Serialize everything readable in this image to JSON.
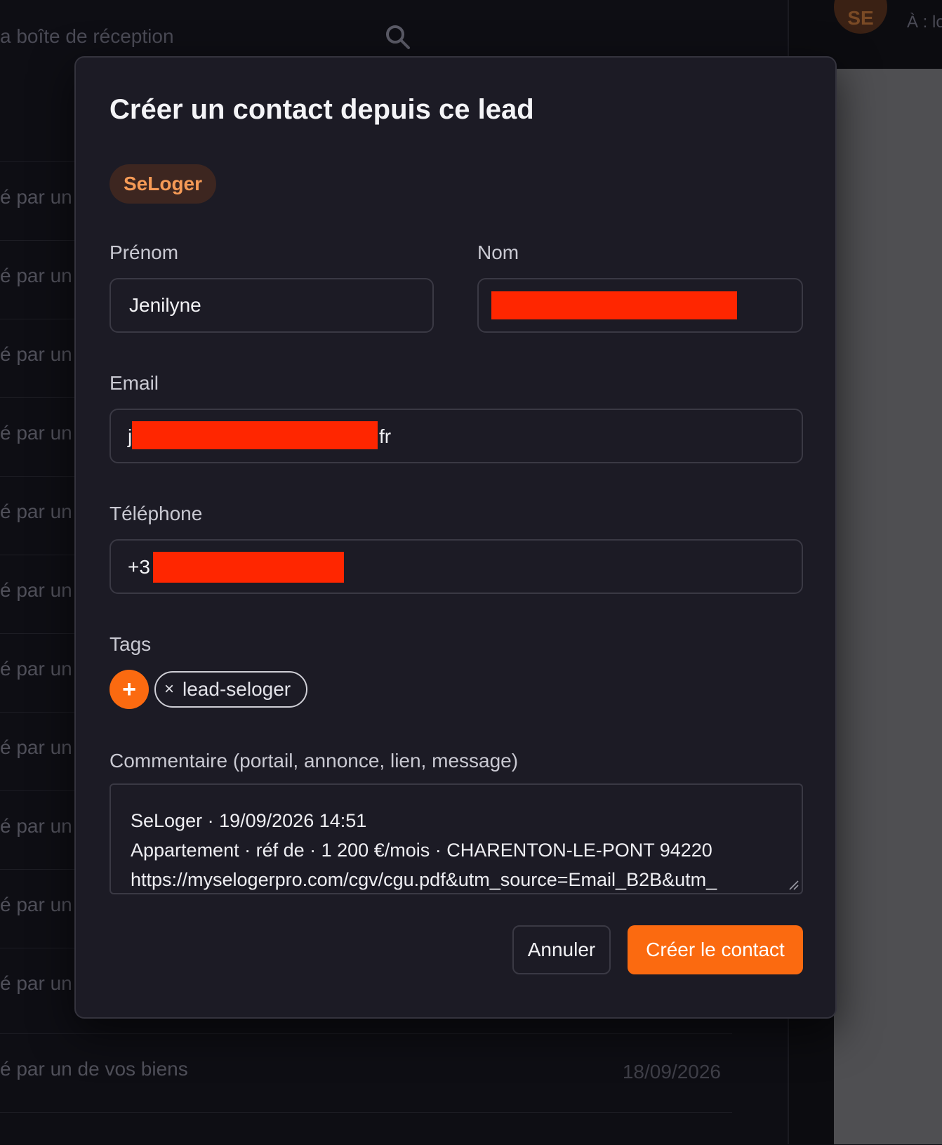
{
  "background": {
    "search_placeholder": "a boîte de réception",
    "avatar_initials": "SE",
    "recipient_prefix": "À : lo",
    "rows": [
      {
        "text": "é par un"
      },
      {
        "text": "é par un"
      },
      {
        "text": "é par un"
      },
      {
        "text": "é par un"
      },
      {
        "text": "é par un"
      },
      {
        "text": "é par un"
      },
      {
        "text": "é par un"
      },
      {
        "text": "é par un"
      },
      {
        "text": "é par un"
      },
      {
        "text": "é par un"
      },
      {
        "text": "é par un"
      }
    ],
    "last_row": {
      "text": "é par un de vos biens",
      "date": "18/09/2026"
    }
  },
  "modal": {
    "title": "Créer un contact depuis ce lead",
    "source_badge": "SeLoger",
    "fields": {
      "first_name": {
        "label": "Prénom",
        "value": "Jenilyne"
      },
      "last_name": {
        "label": "Nom",
        "value": ""
      },
      "email": {
        "label": "Email",
        "value_start": "j",
        "value_end": "fr"
      },
      "phone": {
        "label": "Téléphone",
        "value_start": "+3"
      }
    },
    "tags": {
      "label": "Tags",
      "add_symbol": "+",
      "remove_symbol": "×",
      "items": [
        "lead-seloger"
      ]
    },
    "comment": {
      "label": "Commentaire (portail, annonce, lien, message)",
      "lines": [
        "SeLoger · 19/09/2026 14:51",
        "Appartement · réf de · 1 200 €/mois · CHARENTON-LE-PONT 94220",
        "https://myselogerpro.com/cgv/cgu.pdf&utm_source=Email_B2B&utm_"
      ]
    },
    "buttons": {
      "cancel": "Annuler",
      "submit": "Créer le contact"
    }
  },
  "colors": {
    "accent": "#fb6a10",
    "badge_bg": "#3d2620",
    "badge_text": "#f59a56",
    "redaction": "#ff2600",
    "modal_bg": "#1c1b25"
  }
}
